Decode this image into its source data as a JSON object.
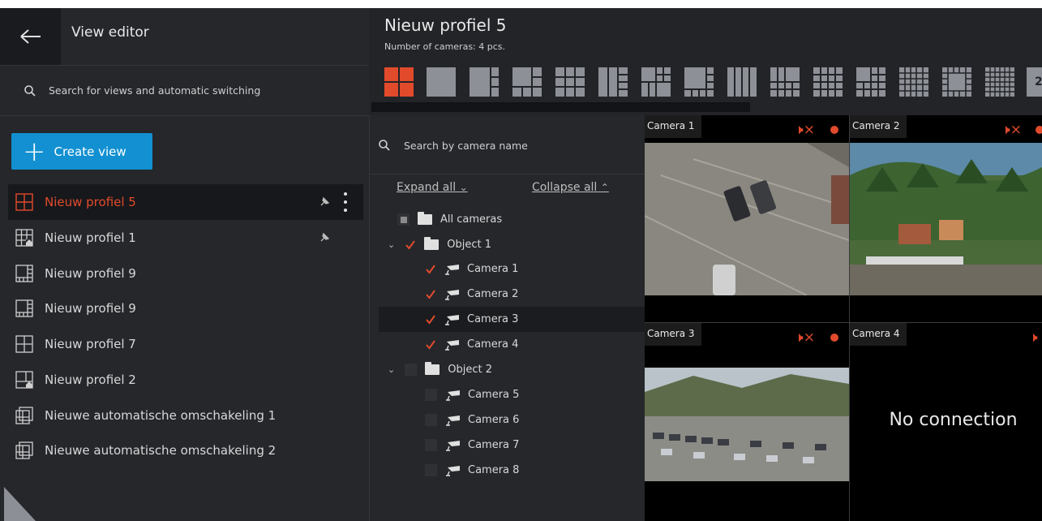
{
  "colors": {
    "accent": "#e24a2c",
    "button": "#1290d1",
    "panel": "#25272b"
  },
  "left": {
    "back_icon": "arrow-left-icon",
    "title": "View editor",
    "search_placeholder": "Search for views and automatic switching",
    "create_label": "Create view",
    "views": [
      {
        "label": "Nieuw profiel 5",
        "icon": "grid-4-icon",
        "active": true,
        "pinned": true
      },
      {
        "label": "Nieuw profiel 1",
        "icon": "grid-home-icon",
        "pinned": true
      },
      {
        "label": "Nieuw profiel 9",
        "icon": "layout-icon"
      },
      {
        "label": "Nieuw profiel 9",
        "icon": "layout-icon"
      },
      {
        "label": "Nieuw profiel 7",
        "icon": "grid-4-icon"
      },
      {
        "label": "Nieuw profiel 2",
        "icon": "layout-home-icon"
      },
      {
        "label": "Nieuwe automatische omschakeling 1",
        "icon": "switching-icon"
      },
      {
        "label": "Nieuwe automatische omschakeling 2",
        "icon": "switching-icon"
      }
    ]
  },
  "header": {
    "title": "Nieuw profiel 5",
    "subtitle": "Number of cameras: 4 pcs.",
    "layout_more": "2"
  },
  "tree": {
    "search_placeholder": "Search by camera name",
    "expand_all": "Expand all",
    "collapse_all": "Collapse all",
    "all_cameras": "All cameras",
    "object1": "Object 1",
    "object2": "Object 2",
    "cameras": [
      "Camera 1",
      "Camera 2",
      "Camera 3",
      "Camera 4",
      "Camera 5",
      "Camera 6",
      "Camera 7",
      "Camera 8"
    ]
  },
  "grid": {
    "tiles": [
      {
        "name": "Camera 1"
      },
      {
        "name": "Camera 2"
      },
      {
        "name": "Camera 3"
      },
      {
        "name": "Camera 4",
        "status": "No connection"
      }
    ]
  }
}
